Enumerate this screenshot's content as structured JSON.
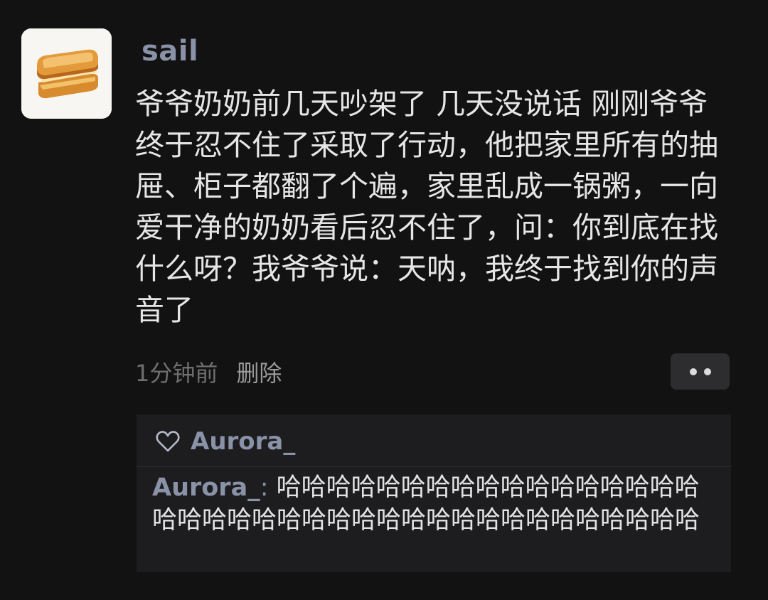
{
  "post": {
    "author": "sail",
    "text": "爷爷奶奶前几天吵架了 几天没说话 刚刚爷爷终于忍不住了采取了行动，他把家里所有的抽屉、柜子都翻了个遍，家里乱成一锅粥，一向爱干净的奶奶看后忍不住了，问：你到底在找什么呀？我爷爷说：天呐，我终于找到你的声音了",
    "time": "1分钟前",
    "delete_label": "删除",
    "more_icon": "more-dots-icon",
    "avatar_icon": "toast-sandwich-icon"
  },
  "likes": {
    "icon": "heart-outline-icon",
    "users": "Aurora_"
  },
  "comments": [
    {
      "author": "Aurora_",
      "separator": ": ",
      "text": "哈哈哈哈哈哈哈哈哈哈哈哈哈哈哈哈哈哈哈哈哈哈哈哈哈哈哈哈哈哈哈哈哈哈哈哈哈哈哈"
    }
  ],
  "colors": {
    "background": "#121212",
    "name_accent": "#8a92a7",
    "text": "#e6e6e6",
    "muted": "#6f6f6f",
    "panel": "#1d1d1f"
  }
}
